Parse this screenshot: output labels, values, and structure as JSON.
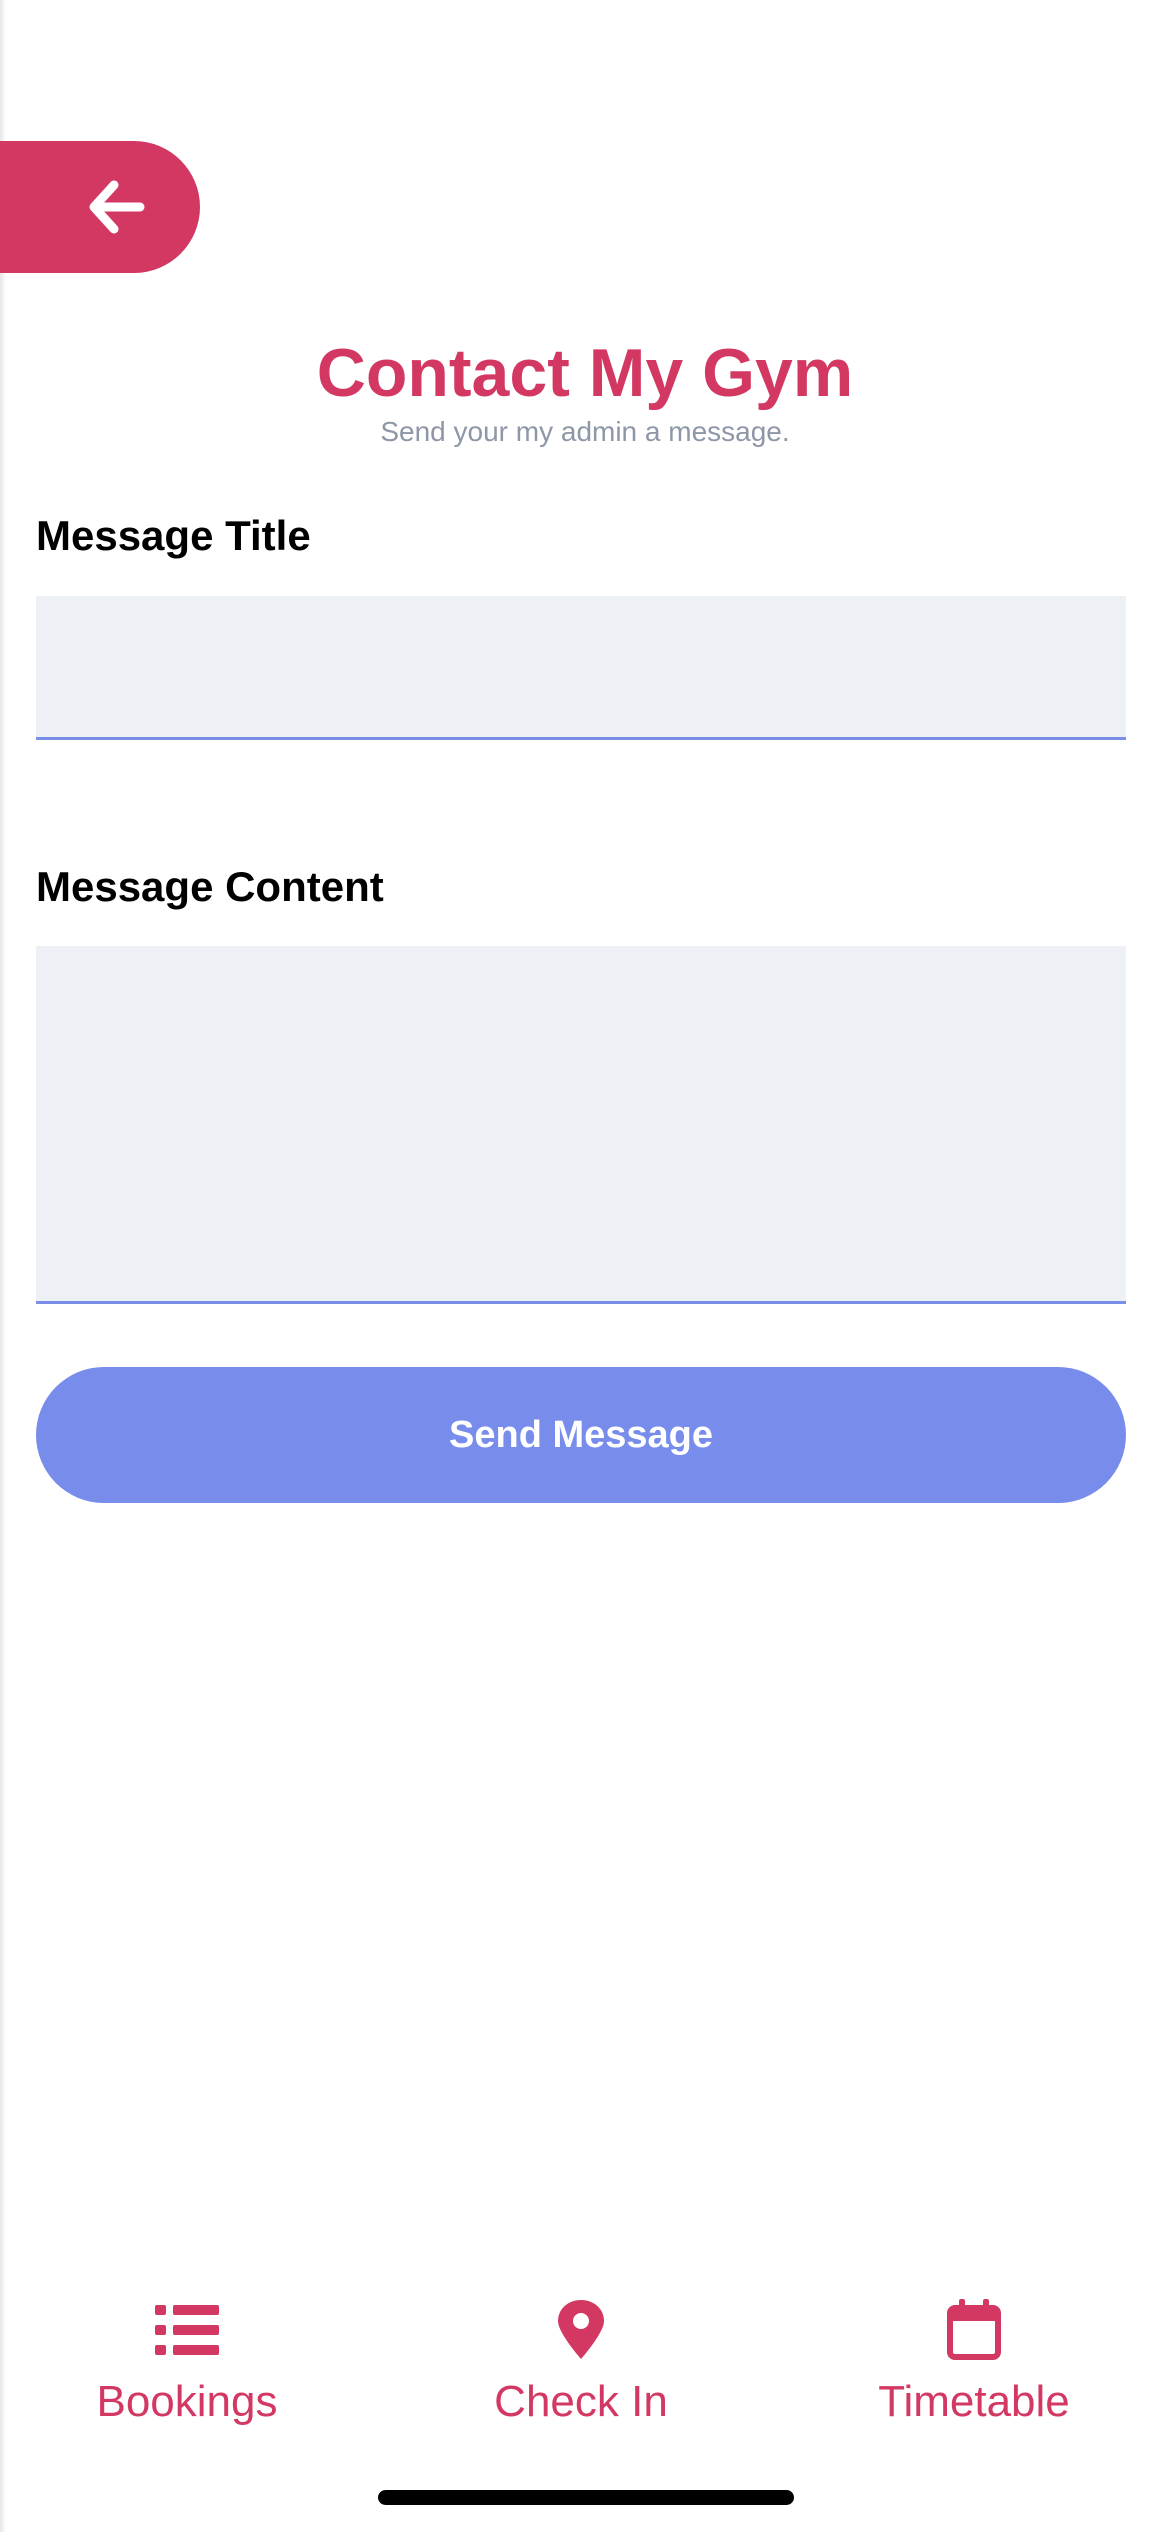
{
  "header": {
    "title": "Contact My Gym",
    "subtitle": "Send your my admin a message."
  },
  "form": {
    "title_label": "Message Title",
    "title_value": "",
    "title_placeholder": "",
    "content_label": "Message Content",
    "content_value": "",
    "content_placeholder": "",
    "send_label": "Send Message"
  },
  "tabs": [
    {
      "label": "Bookings",
      "icon": "list-icon"
    },
    {
      "label": "Check In",
      "icon": "map-pin-icon"
    },
    {
      "label": "Timetable",
      "icon": "calendar-icon"
    }
  ],
  "colors": {
    "accent": "#d33863",
    "button": "#778ceb",
    "input_bg": "#edf1f6",
    "input_border": "#7a8ee8",
    "subtitle": "#8d97a6"
  }
}
